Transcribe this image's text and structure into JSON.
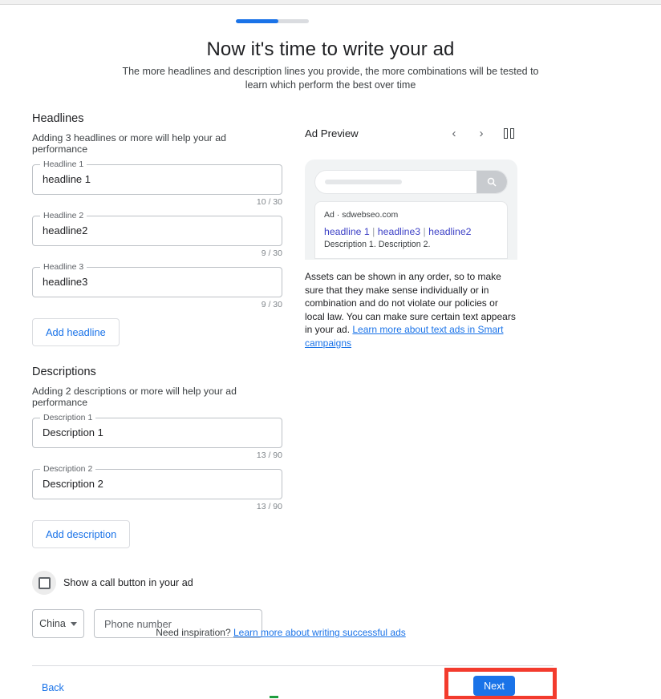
{
  "progress": {
    "percent": 58
  },
  "header": {
    "title": "Now it's time to write your ad",
    "subtitle": "The more headlines and description lines you provide, the more combinations will be tested to learn which perform the best over time"
  },
  "headlines": {
    "section_title": "Headlines",
    "section_subtitle": "Adding 3 headlines or more will help your ad performance",
    "fields": [
      {
        "label": "Headline 1",
        "value": "headline 1",
        "counter": "10 / 30"
      },
      {
        "label": "Headline 2",
        "value": "headline2",
        "counter": "9 / 30"
      },
      {
        "label": "Headline 3",
        "value": "headline3",
        "counter": "9 / 30"
      }
    ],
    "add_button": "Add headline"
  },
  "descriptions": {
    "section_title": "Descriptions",
    "section_subtitle": "Adding 2 descriptions or more will help your ad performance",
    "fields": [
      {
        "label": "Description 1",
        "value": "Description 1",
        "counter": "13 / 90"
      },
      {
        "label": "Description 2",
        "value": "Description 2",
        "counter": "13 / 90"
      }
    ],
    "add_button": "Add description"
  },
  "call_option": {
    "checkbox_label": "Show a call button in your ad",
    "checked": false,
    "country": "China",
    "phone_placeholder": "Phone number",
    "phone_value": ""
  },
  "preview": {
    "title": "Ad Preview",
    "prev_icon": "‹",
    "next_icon": "›",
    "layout_icon": "side-by-side-view-icon",
    "search_icon": "⚲",
    "ad_label": "Ad",
    "ad_separator": "·",
    "ad_domain": "sdwebseo.com",
    "headline_parts": [
      "headline 1",
      "headline3",
      "headline2"
    ],
    "headline_separator": " | ",
    "description_line": "Description 1. Description 2.",
    "assets_note_text": "Assets can be shown in any order, so to make sure that they make sense individually or in combination and do not violate our policies or local law. You can make sure certain text appears in your ad. ",
    "assets_note_link": "Learn more about text ads in Smart campaigns"
  },
  "footer": {
    "inspiration_text": "Need inspiration? ",
    "inspiration_link": "Learn more about writing successful ads",
    "back_label": "Back",
    "next_label": "Next"
  },
  "colors": {
    "accent_blue": "#1a73e8",
    "highlight_red": "#f33b2d",
    "link_purple": "#3d41c6",
    "green_accent": "#1e9e3e"
  }
}
